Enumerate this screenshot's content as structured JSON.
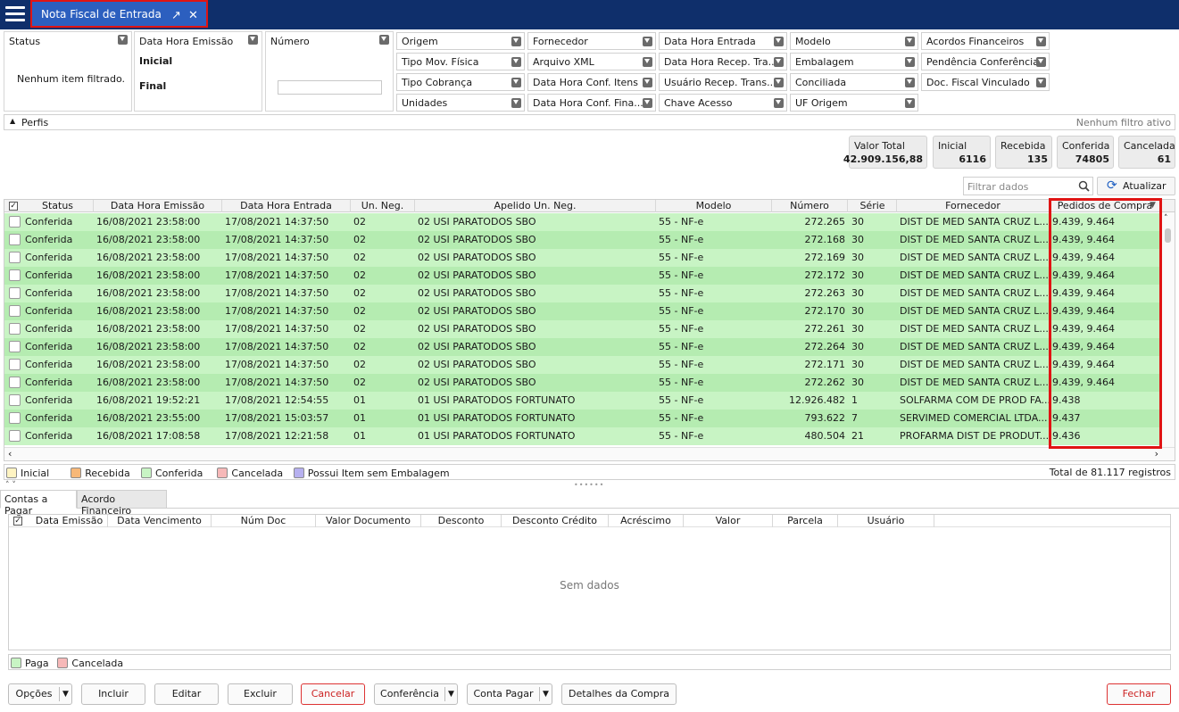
{
  "tab": {
    "title": "Nota Fiscal de Entrada"
  },
  "filters": {
    "status": {
      "label": "Status",
      "empty_text": "Nenhum item filtrado."
    },
    "data_hora_emissao": {
      "label": "Data Hora Emissão",
      "inicial": "Inicial",
      "final": "Final"
    },
    "numero": {
      "label": "Número",
      "value": ""
    },
    "grid": [
      [
        "Origem",
        "Fornecedor",
        "Data Hora Entrada",
        "Modelo",
        "Acordos Financeiros"
      ],
      [
        "Tipo Mov. Física",
        "Arquivo XML",
        "Data Hora Recep. Tra...",
        "Embalagem",
        "Pendência Conferência"
      ],
      [
        "Tipo Cobrança",
        "Data Hora Conf. Itens",
        "Usuário Recep. Trans...",
        "Conciliada",
        "Doc. Fiscal Vinculado"
      ],
      [
        "Unidades",
        "Data Hora Conf. Fina...",
        "Chave Acesso",
        "UF Origem",
        ""
      ]
    ]
  },
  "perfis": {
    "label": "Perfis",
    "status": "Nenhum filtro ativo"
  },
  "summary": [
    {
      "label": "Valor Total",
      "value": "42.909.156,88"
    },
    {
      "label": "Inicial",
      "value": "6116"
    },
    {
      "label": "Recebida",
      "value": "135"
    },
    {
      "label": "Conferida",
      "value": "74805"
    },
    {
      "label": "Cancelada",
      "value": "61"
    }
  ],
  "search": {
    "placeholder": "Filtrar dados"
  },
  "refresh_label": "Atualizar",
  "table": {
    "headers": [
      "Status",
      "Data Hora Emissão",
      "Data Hora Entrada",
      "Un. Neg.",
      "Apelido Un. Neg.",
      "Modelo",
      "Número",
      "Série",
      "Fornecedor",
      "Pedidos de Compra"
    ],
    "rows": [
      [
        "Conferida",
        "16/08/2021 23:58:00",
        "17/08/2021 14:37:50",
        "02",
        "02 USI PARATODOS SBO",
        "55 - NF-e",
        "272.265",
        "30",
        "DIST DE MED SANTA CRUZ L...",
        "9.439, 9.464"
      ],
      [
        "Conferida",
        "16/08/2021 23:58:00",
        "17/08/2021 14:37:50",
        "02",
        "02 USI PARATODOS SBO",
        "55 - NF-e",
        "272.168",
        "30",
        "DIST DE MED SANTA CRUZ L...",
        "9.439, 9.464"
      ],
      [
        "Conferida",
        "16/08/2021 23:58:00",
        "17/08/2021 14:37:50",
        "02",
        "02 USI PARATODOS SBO",
        "55 - NF-e",
        "272.169",
        "30",
        "DIST DE MED SANTA CRUZ L...",
        "9.439, 9.464"
      ],
      [
        "Conferida",
        "16/08/2021 23:58:00",
        "17/08/2021 14:37:50",
        "02",
        "02 USI PARATODOS SBO",
        "55 - NF-e",
        "272.172",
        "30",
        "DIST DE MED SANTA CRUZ L...",
        "9.439, 9.464"
      ],
      [
        "Conferida",
        "16/08/2021 23:58:00",
        "17/08/2021 14:37:50",
        "02",
        "02 USI PARATODOS SBO",
        "55 - NF-e",
        "272.263",
        "30",
        "DIST DE MED SANTA CRUZ L...",
        "9.439, 9.464"
      ],
      [
        "Conferida",
        "16/08/2021 23:58:00",
        "17/08/2021 14:37:50",
        "02",
        "02 USI PARATODOS SBO",
        "55 - NF-e",
        "272.170",
        "30",
        "DIST DE MED SANTA CRUZ L...",
        "9.439, 9.464"
      ],
      [
        "Conferida",
        "16/08/2021 23:58:00",
        "17/08/2021 14:37:50",
        "02",
        "02 USI PARATODOS SBO",
        "55 - NF-e",
        "272.261",
        "30",
        "DIST DE MED SANTA CRUZ L...",
        "9.439, 9.464"
      ],
      [
        "Conferida",
        "16/08/2021 23:58:00",
        "17/08/2021 14:37:50",
        "02",
        "02 USI PARATODOS SBO",
        "55 - NF-e",
        "272.264",
        "30",
        "DIST DE MED SANTA CRUZ L...",
        "9.439, 9.464"
      ],
      [
        "Conferida",
        "16/08/2021 23:58:00",
        "17/08/2021 14:37:50",
        "02",
        "02 USI PARATODOS SBO",
        "55 - NF-e",
        "272.171",
        "30",
        "DIST DE MED SANTA CRUZ L...",
        "9.439, 9.464"
      ],
      [
        "Conferida",
        "16/08/2021 23:58:00",
        "17/08/2021 14:37:50",
        "02",
        "02 USI PARATODOS SBO",
        "55 - NF-e",
        "272.262",
        "30",
        "DIST DE MED SANTA CRUZ L...",
        "9.439, 9.464"
      ],
      [
        "Conferida",
        "16/08/2021 19:52:21",
        "17/08/2021 12:54:55",
        "01",
        "01 USI PARATODOS FORTUNATO",
        "55 - NF-e",
        "12.926.482",
        "1",
        "SOLFARMA COM DE PROD FA...",
        "9.438"
      ],
      [
        "Conferida",
        "16/08/2021 23:55:00",
        "17/08/2021 15:03:57",
        "01",
        "01 USI PARATODOS FORTUNATO",
        "55 - NF-e",
        "793.622",
        "7",
        "SERVIMED COMERCIAL LTDA...",
        "9.437"
      ],
      [
        "Conferida",
        "16/08/2021 17:08:58",
        "17/08/2021 12:21:58",
        "01",
        "01 USI PARATODOS FORTUNATO",
        "55 - NF-e",
        "480.504",
        "21",
        "PROFARMA DIST DE PRODUT...",
        "9.436"
      ]
    ]
  },
  "legend": {
    "items": [
      {
        "label": "Inicial",
        "color": "#fff4c2"
      },
      {
        "label": "Recebida",
        "color": "#f7b878"
      },
      {
        "label": "Conferida",
        "color": "#c8f4c4"
      },
      {
        "label": "Cancelada",
        "color": "#f6b8b8"
      },
      {
        "label": "Possui Item sem Embalagem",
        "color": "#b6b0ef"
      }
    ],
    "total": "Total de 81.117 registros"
  },
  "panel_tabs": [
    "Contas a Pagar",
    "Acordo Financeiro"
  ],
  "sub_table": {
    "headers": [
      "Data Emissão",
      "Data Vencimento",
      "Núm Doc",
      "Valor Documento",
      "Desconto",
      "Desconto Crédito",
      "Acréscimo",
      "Valor",
      "Parcela",
      "Usuário"
    ],
    "empty": "Sem dados"
  },
  "sub_legend": [
    {
      "label": "Paga",
      "color": "#c8f4c4"
    },
    {
      "label": "Cancelada",
      "color": "#f6b8b8"
    }
  ],
  "buttons": {
    "opcoes": "Opções",
    "incluir": "Incluir",
    "editar": "Editar",
    "excluir": "Excluir",
    "cancelar": "Cancelar",
    "conferencia": "Conferência",
    "conta_pagar": "Conta Pagar",
    "detalhes": "Detalhes da Compra",
    "fechar": "Fechar"
  },
  "colors": {
    "topbar": "#0f2f6b",
    "tab": "#2c5fbf",
    "highlight": "#e01414",
    "row_a": "#c8f4c4",
    "row_b": "#b5ecb1"
  }
}
